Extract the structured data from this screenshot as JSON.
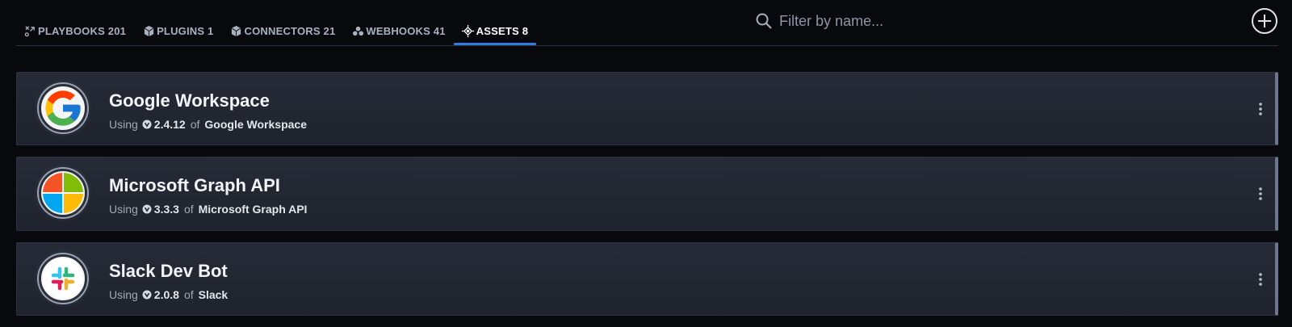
{
  "tabs": [
    {
      "label": "PLAYBOOKS 201",
      "icon": "playbooks-icon",
      "active": false
    },
    {
      "label": "PLUGINS 1",
      "icon": "plugins-icon",
      "active": false
    },
    {
      "label": "CONNECTORS 21",
      "icon": "connectors-icon",
      "active": false
    },
    {
      "label": "WEBHOOKS 41",
      "icon": "webhooks-icon",
      "active": false
    },
    {
      "label": "ASSETS 8",
      "icon": "assets-icon",
      "active": true
    }
  ],
  "search": {
    "placeholder": "Filter by name...",
    "value": ""
  },
  "add_button": {
    "icon": "plus-circle-icon"
  },
  "assets": [
    {
      "name": "Google Workspace",
      "using_label": "Using",
      "version": "2.4.12",
      "of_label": "of",
      "connector": "Google Workspace",
      "logo": "google-logo-icon"
    },
    {
      "name": "Microsoft Graph API",
      "using_label": "Using",
      "version": "3.3.3",
      "of_label": "of",
      "connector": "Microsoft Graph API",
      "logo": "microsoft-logo-icon"
    },
    {
      "name": "Slack Dev Bot",
      "using_label": "Using",
      "version": "2.0.8",
      "of_label": "of",
      "connector": "Slack",
      "logo": "slack-logo-icon"
    }
  ],
  "colors": {
    "background": "#07090d",
    "card": "#232833",
    "accent": "#2f7de1",
    "card_edge": "#6d7890"
  }
}
